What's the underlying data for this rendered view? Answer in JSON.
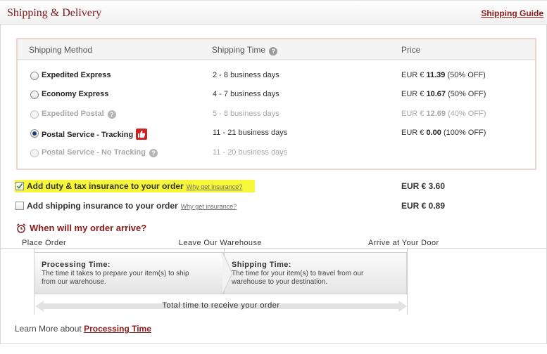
{
  "header": {
    "title": "Shipping & Delivery",
    "guide_link": "Shipping Guide"
  },
  "table": {
    "col_method": "Shipping Method",
    "col_time": "Shipping Time",
    "col_price": "Price",
    "rows": [
      {
        "name": "Expedited Express",
        "time": "2 - 8 business days",
        "currency": "EUR €",
        "amount": "11.39",
        "discount": "(50% OFF)",
        "selected": false,
        "disabled": false
      },
      {
        "name": "Economy Express",
        "time": "4 - 7 business days",
        "currency": "EUR €",
        "amount": "10.67",
        "discount": "(50% OFF)",
        "selected": false,
        "disabled": false
      },
      {
        "name": "Expedited Postal",
        "time": "5 - 8 business days",
        "currency": "EUR €",
        "amount": "12.69",
        "discount": "(40% OFF)",
        "selected": false,
        "disabled": true
      },
      {
        "name": "Postal Service - Tracking",
        "time": "11 - 21 business days",
        "currency": "EUR €",
        "amount": "0.00",
        "discount": "(100% OFF)",
        "selected": true,
        "disabled": false
      },
      {
        "name": "Postal Service - No Tracking",
        "time": "11 - 20 business days",
        "currency": "",
        "amount": "",
        "discount": "",
        "selected": false,
        "disabled": true
      }
    ]
  },
  "options": {
    "duty": {
      "label": "Add duty & tax insurance to your order",
      "link": "Why get insurance?",
      "price": "EUR € 3.60",
      "checked": true
    },
    "shipping_ins": {
      "label": "Add shipping insurance to your order",
      "link": "Why get insurance?",
      "price": "EUR € 0.89",
      "checked": false
    }
  },
  "arrival": {
    "title": "When will my order arrive?",
    "steps": [
      "Place Order",
      "Leave Our Warehouse",
      "Arrive at Your Door"
    ],
    "processing": {
      "title": "Processing Time:",
      "text1": "The time it takes to prepare your item(s) to ship",
      "text2": "from our warehouse."
    },
    "shipping": {
      "title": "Shipping Time:",
      "text1": "The time  for your item(s) to travel from our",
      "text2": "warehouse to your destination."
    },
    "total": "Total time to receive your order"
  },
  "learn": {
    "prefix": "Learn More about",
    "link": "Processing Time"
  },
  "colors": {
    "accent": "#8b1a1a",
    "highlight": "#f7f73a",
    "thumb": "#d02020"
  },
  "icons": {
    "help": "question-mark-icon",
    "recommended": "thumbs-up-icon",
    "clock": "alarm-clock-icon"
  }
}
